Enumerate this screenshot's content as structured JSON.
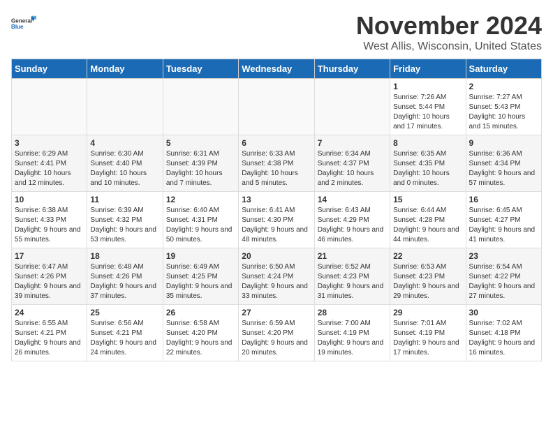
{
  "logo": {
    "line1": "General",
    "line2": "Blue"
  },
  "title": "November 2024",
  "location": "West Allis, Wisconsin, United States",
  "weekdays": [
    "Sunday",
    "Monday",
    "Tuesday",
    "Wednesday",
    "Thursday",
    "Friday",
    "Saturday"
  ],
  "weeks": [
    [
      {
        "day": "",
        "info": ""
      },
      {
        "day": "",
        "info": ""
      },
      {
        "day": "",
        "info": ""
      },
      {
        "day": "",
        "info": ""
      },
      {
        "day": "",
        "info": ""
      },
      {
        "day": "1",
        "info": "Sunrise: 7:26 AM\nSunset: 5:44 PM\nDaylight: 10 hours and 17 minutes."
      },
      {
        "day": "2",
        "info": "Sunrise: 7:27 AM\nSunset: 5:43 PM\nDaylight: 10 hours and 15 minutes."
      }
    ],
    [
      {
        "day": "3",
        "info": "Sunrise: 6:29 AM\nSunset: 4:41 PM\nDaylight: 10 hours and 12 minutes."
      },
      {
        "day": "4",
        "info": "Sunrise: 6:30 AM\nSunset: 4:40 PM\nDaylight: 10 hours and 10 minutes."
      },
      {
        "day": "5",
        "info": "Sunrise: 6:31 AM\nSunset: 4:39 PM\nDaylight: 10 hours and 7 minutes."
      },
      {
        "day": "6",
        "info": "Sunrise: 6:33 AM\nSunset: 4:38 PM\nDaylight: 10 hours and 5 minutes."
      },
      {
        "day": "7",
        "info": "Sunrise: 6:34 AM\nSunset: 4:37 PM\nDaylight: 10 hours and 2 minutes."
      },
      {
        "day": "8",
        "info": "Sunrise: 6:35 AM\nSunset: 4:35 PM\nDaylight: 10 hours and 0 minutes."
      },
      {
        "day": "9",
        "info": "Sunrise: 6:36 AM\nSunset: 4:34 PM\nDaylight: 9 hours and 57 minutes."
      }
    ],
    [
      {
        "day": "10",
        "info": "Sunrise: 6:38 AM\nSunset: 4:33 PM\nDaylight: 9 hours and 55 minutes."
      },
      {
        "day": "11",
        "info": "Sunrise: 6:39 AM\nSunset: 4:32 PM\nDaylight: 9 hours and 53 minutes."
      },
      {
        "day": "12",
        "info": "Sunrise: 6:40 AM\nSunset: 4:31 PM\nDaylight: 9 hours and 50 minutes."
      },
      {
        "day": "13",
        "info": "Sunrise: 6:41 AM\nSunset: 4:30 PM\nDaylight: 9 hours and 48 minutes."
      },
      {
        "day": "14",
        "info": "Sunrise: 6:43 AM\nSunset: 4:29 PM\nDaylight: 9 hours and 46 minutes."
      },
      {
        "day": "15",
        "info": "Sunrise: 6:44 AM\nSunset: 4:28 PM\nDaylight: 9 hours and 44 minutes."
      },
      {
        "day": "16",
        "info": "Sunrise: 6:45 AM\nSunset: 4:27 PM\nDaylight: 9 hours and 41 minutes."
      }
    ],
    [
      {
        "day": "17",
        "info": "Sunrise: 6:47 AM\nSunset: 4:26 PM\nDaylight: 9 hours and 39 minutes."
      },
      {
        "day": "18",
        "info": "Sunrise: 6:48 AM\nSunset: 4:26 PM\nDaylight: 9 hours and 37 minutes."
      },
      {
        "day": "19",
        "info": "Sunrise: 6:49 AM\nSunset: 4:25 PM\nDaylight: 9 hours and 35 minutes."
      },
      {
        "day": "20",
        "info": "Sunrise: 6:50 AM\nSunset: 4:24 PM\nDaylight: 9 hours and 33 minutes."
      },
      {
        "day": "21",
        "info": "Sunrise: 6:52 AM\nSunset: 4:23 PM\nDaylight: 9 hours and 31 minutes."
      },
      {
        "day": "22",
        "info": "Sunrise: 6:53 AM\nSunset: 4:23 PM\nDaylight: 9 hours and 29 minutes."
      },
      {
        "day": "23",
        "info": "Sunrise: 6:54 AM\nSunset: 4:22 PM\nDaylight: 9 hours and 27 minutes."
      }
    ],
    [
      {
        "day": "24",
        "info": "Sunrise: 6:55 AM\nSunset: 4:21 PM\nDaylight: 9 hours and 26 minutes."
      },
      {
        "day": "25",
        "info": "Sunrise: 6:56 AM\nSunset: 4:21 PM\nDaylight: 9 hours and 24 minutes."
      },
      {
        "day": "26",
        "info": "Sunrise: 6:58 AM\nSunset: 4:20 PM\nDaylight: 9 hours and 22 minutes."
      },
      {
        "day": "27",
        "info": "Sunrise: 6:59 AM\nSunset: 4:20 PM\nDaylight: 9 hours and 20 minutes."
      },
      {
        "day": "28",
        "info": "Sunrise: 7:00 AM\nSunset: 4:19 PM\nDaylight: 9 hours and 19 minutes."
      },
      {
        "day": "29",
        "info": "Sunrise: 7:01 AM\nSunset: 4:19 PM\nDaylight: 9 hours and 17 minutes."
      },
      {
        "day": "30",
        "info": "Sunrise: 7:02 AM\nSunset: 4:18 PM\nDaylight: 9 hours and 16 minutes."
      }
    ]
  ]
}
